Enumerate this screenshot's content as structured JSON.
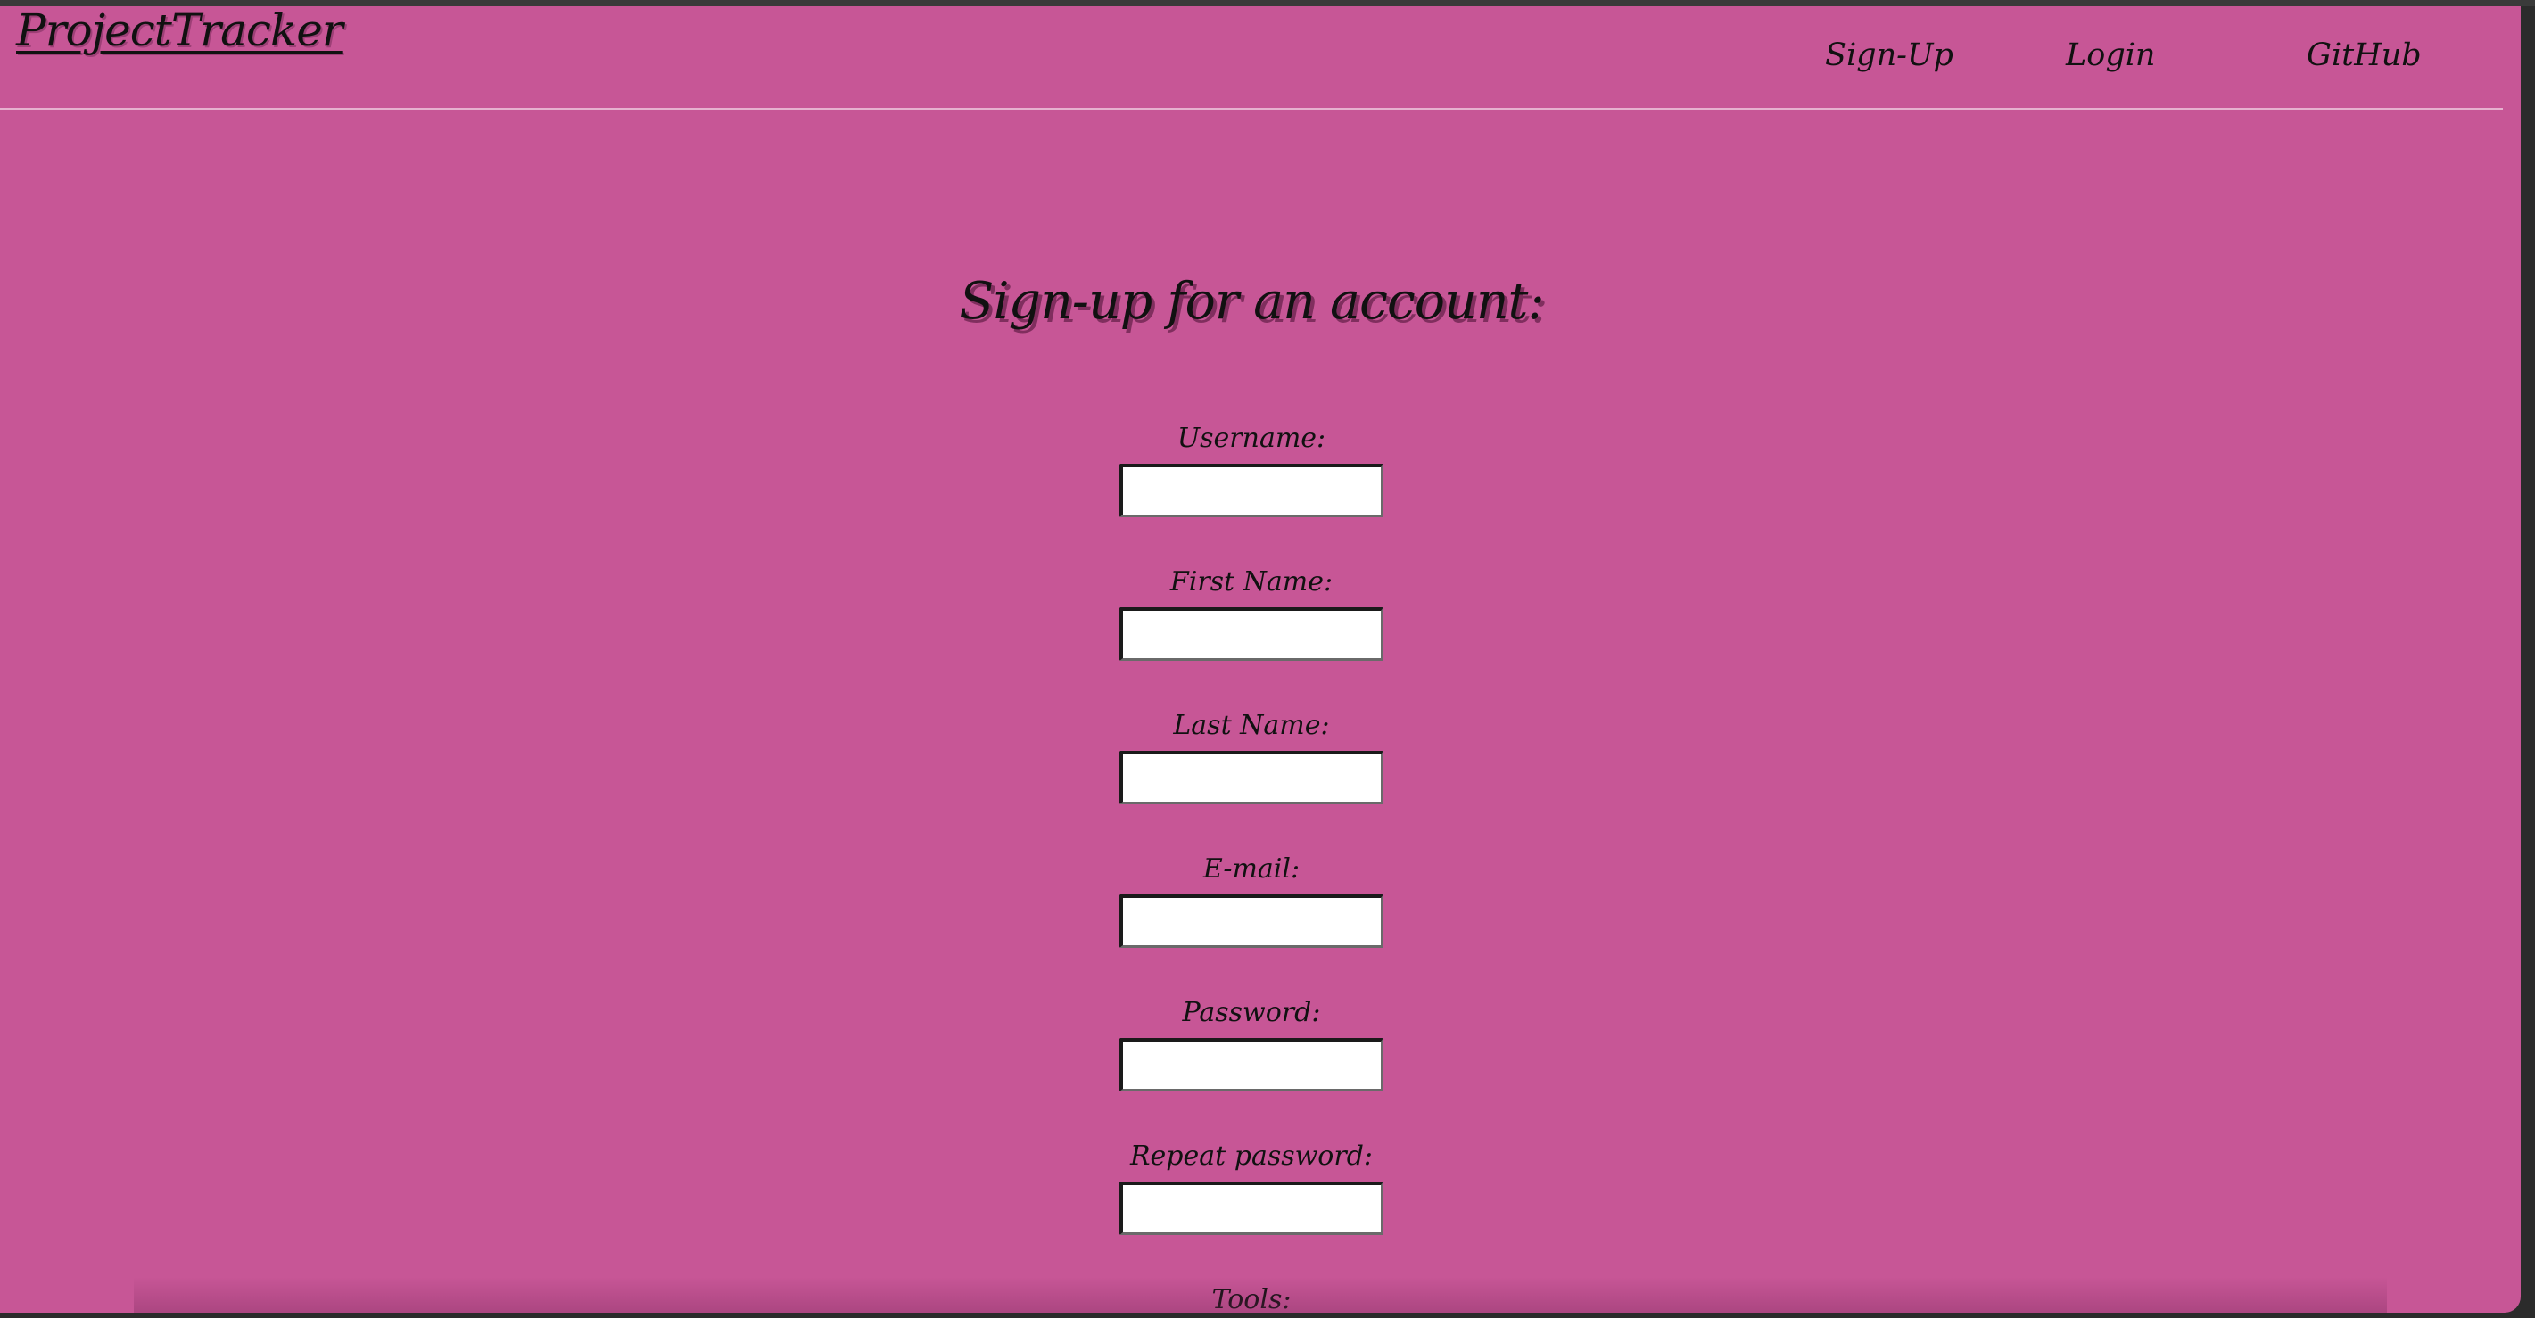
{
  "header": {
    "brand": "ProjectTracker",
    "nav": {
      "signup": "Sign-Up",
      "login": "Login",
      "github": "GitHub"
    }
  },
  "main": {
    "title": "Sign-up for an account:",
    "fields": {
      "username": {
        "label": "Username:",
        "value": ""
      },
      "first_name": {
        "label": "First Name:",
        "value": ""
      },
      "last_name": {
        "label": "Last Name:",
        "value": ""
      },
      "email": {
        "label": "E-mail:",
        "value": ""
      },
      "password": {
        "label": "Password:",
        "value": ""
      },
      "repeat_password": {
        "label": "Repeat password:",
        "value": ""
      },
      "tools": {
        "label": "Tools:"
      }
    }
  },
  "colors": {
    "background": "#c75696",
    "text": "#111111",
    "input_background": "#ffffff"
  }
}
